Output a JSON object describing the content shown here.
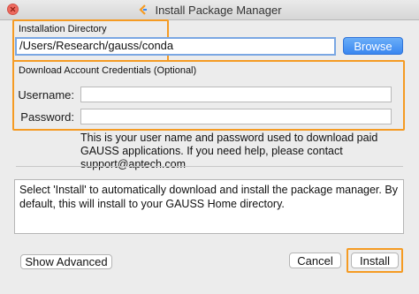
{
  "window": {
    "title": "Install Package Manager",
    "icons": {
      "close": "close-icon",
      "app": "gauss-app-icon"
    }
  },
  "install_dir": {
    "section_label": "Installation Directory",
    "value": "/Users/Research/gauss/conda",
    "browse_label": "Browse"
  },
  "credentials": {
    "section_label": "Download Account Credentials (Optional)",
    "username_label": "Username:",
    "username_value": "",
    "password_label": "Password:",
    "password_value": "",
    "help_text": "This is your user name and password used to download paid GAUSS applications. If you need help, please contact support@aptech.com"
  },
  "message": "Select 'Install' to automatically download and install the package manager. By default, this will install to your GAUSS Home directory.",
  "buttons": {
    "show_advanced": "Show Advanced",
    "cancel": "Cancel",
    "install": "Install"
  },
  "colors": {
    "highlight": "#f59b23",
    "primary_button": "#3a87f0",
    "close_button": "#ee6a5f"
  }
}
